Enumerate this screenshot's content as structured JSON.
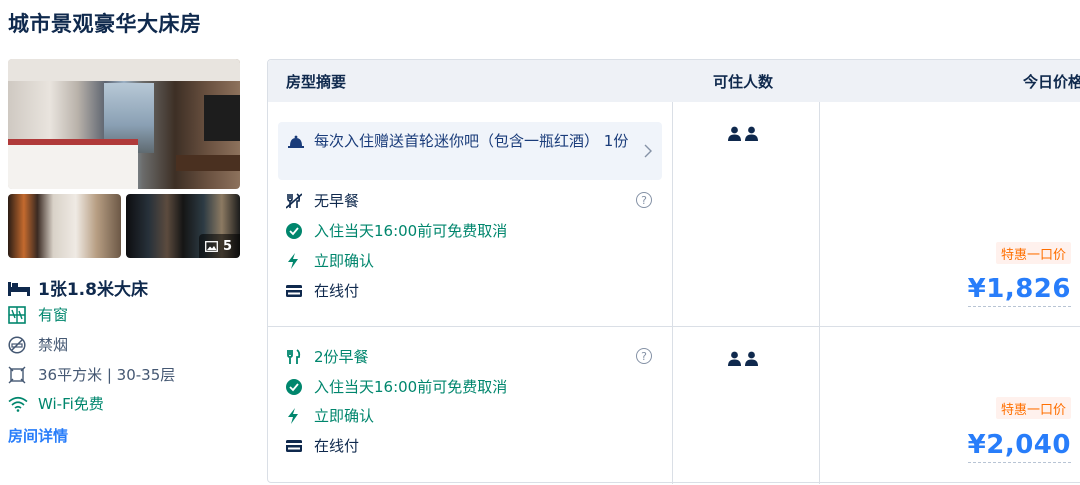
{
  "room": {
    "title": "城市景观豪华大床房",
    "photo_count": "5",
    "features": {
      "bed": "1张1.8米大床",
      "window": "有窗",
      "smoking": "禁烟",
      "area_floor": "36平方米 | 30-35层",
      "wifi": "Wi-Fi免费"
    },
    "details_link": "房间详情"
  },
  "table": {
    "headers": {
      "summary": "房型摘要",
      "guests": "可住人数",
      "price": "今日价格"
    },
    "offers": [
      {
        "promo": "每次入住赠送首轮迷你吧（包含一瓶红酒） 1份",
        "breakfast": "无早餐",
        "cancel": "入住当天16:00前可免费取消",
        "confirm": "立即确认",
        "payment": "在线付",
        "guests_count": 2,
        "badge": "特惠一口价",
        "price": "¥1,826"
      },
      {
        "breakfast": "2份早餐",
        "cancel": "入住当天16:00前可免费取消",
        "confirm": "立即确认",
        "payment": "在线付",
        "guests_count": 2,
        "badge": "特惠一口价",
        "price": "¥2,040"
      }
    ]
  },
  "colors": {
    "primary_text": "#0f294d",
    "green": "#00866d",
    "blue": "#287dfa",
    "orange": "#ff6f00"
  }
}
